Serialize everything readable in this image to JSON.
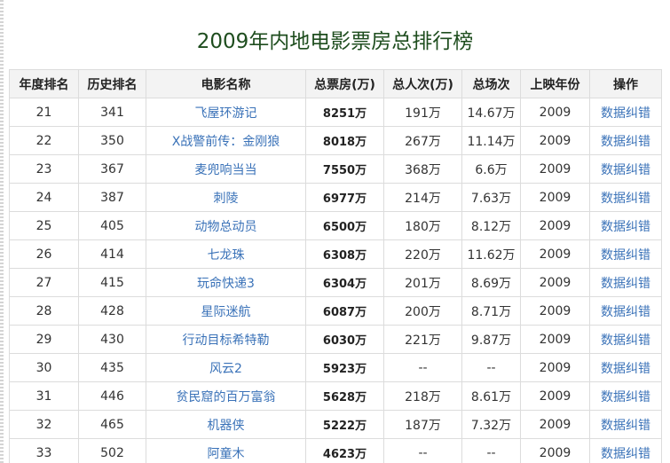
{
  "title": "2009年内地电影票房总排行榜",
  "table": {
    "headers": [
      "年度排名",
      "历史排名",
      "电影名称",
      "总票房(万)",
      "总人次(万)",
      "总场次",
      "上映年份",
      "操作"
    ],
    "rows": [
      {
        "year_rank": "21",
        "history_rank": "341",
        "movie": "飞屋环游记",
        "gross": "8251万",
        "admissions": "191万",
        "screenings": "14.67万",
        "year": "2009",
        "action": "数据纠错"
      },
      {
        "year_rank": "22",
        "history_rank": "350",
        "movie": "X战警前传：金刚狼",
        "gross": "8018万",
        "admissions": "267万",
        "screenings": "11.14万",
        "year": "2009",
        "action": "数据纠错"
      },
      {
        "year_rank": "23",
        "history_rank": "367",
        "movie": "麦兜响当当",
        "gross": "7550万",
        "admissions": "368万",
        "screenings": "6.6万",
        "year": "2009",
        "action": "数据纠错"
      },
      {
        "year_rank": "24",
        "history_rank": "387",
        "movie": "刺陵",
        "gross": "6977万",
        "admissions": "214万",
        "screenings": "7.63万",
        "year": "2009",
        "action": "数据纠错"
      },
      {
        "year_rank": "25",
        "history_rank": "405",
        "movie": "动物总动员",
        "gross": "6500万",
        "admissions": "180万",
        "screenings": "8.12万",
        "year": "2009",
        "action": "数据纠错"
      },
      {
        "year_rank": "26",
        "history_rank": "414",
        "movie": "七龙珠",
        "gross": "6308万",
        "admissions": "220万",
        "screenings": "11.62万",
        "year": "2009",
        "action": "数据纠错"
      },
      {
        "year_rank": "27",
        "history_rank": "415",
        "movie": "玩命快递3",
        "gross": "6304万",
        "admissions": "201万",
        "screenings": "8.69万",
        "year": "2009",
        "action": "数据纠错"
      },
      {
        "year_rank": "28",
        "history_rank": "428",
        "movie": "星际迷航",
        "gross": "6087万",
        "admissions": "200万",
        "screenings": "8.71万",
        "year": "2009",
        "action": "数据纠错"
      },
      {
        "year_rank": "29",
        "history_rank": "430",
        "movie": "行动目标希特勒",
        "gross": "6030万",
        "admissions": "221万",
        "screenings": "9.87万",
        "year": "2009",
        "action": "数据纠错"
      },
      {
        "year_rank": "30",
        "history_rank": "435",
        "movie": "风云2",
        "gross": "5923万",
        "admissions": "--",
        "screenings": "--",
        "year": "2009",
        "action": "数据纠错"
      },
      {
        "year_rank": "31",
        "history_rank": "446",
        "movie": "贫民窟的百万富翁",
        "gross": "5628万",
        "admissions": "218万",
        "screenings": "8.61万",
        "year": "2009",
        "action": "数据纠错"
      },
      {
        "year_rank": "32",
        "history_rank": "465",
        "movie": "机器侠",
        "gross": "5222万",
        "admissions": "187万",
        "screenings": "7.32万",
        "year": "2009",
        "action": "数据纠错"
      },
      {
        "year_rank": "33",
        "history_rank": "502",
        "movie": "阿童木",
        "gross": "4623万",
        "admissions": "--",
        "screenings": "--",
        "year": "2009",
        "action": "数据纠错"
      }
    ]
  }
}
